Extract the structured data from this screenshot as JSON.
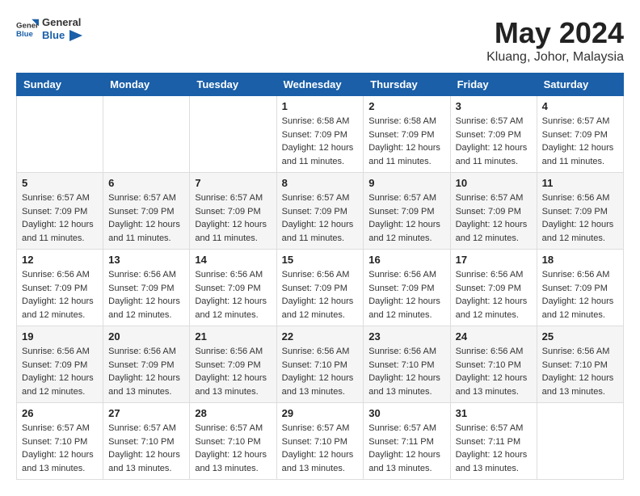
{
  "header": {
    "logo_general": "General",
    "logo_blue": "Blue",
    "title": "May 2024",
    "location": "Kluang, Johor, Malaysia"
  },
  "weekdays": [
    "Sunday",
    "Monday",
    "Tuesday",
    "Wednesday",
    "Thursday",
    "Friday",
    "Saturday"
  ],
  "weeks": [
    [
      {
        "day": "",
        "info": ""
      },
      {
        "day": "",
        "info": ""
      },
      {
        "day": "",
        "info": ""
      },
      {
        "day": "1",
        "info": "Sunrise: 6:58 AM\nSunset: 7:09 PM\nDaylight: 12 hours and 11 minutes."
      },
      {
        "day": "2",
        "info": "Sunrise: 6:58 AM\nSunset: 7:09 PM\nDaylight: 12 hours and 11 minutes."
      },
      {
        "day": "3",
        "info": "Sunrise: 6:57 AM\nSunset: 7:09 PM\nDaylight: 12 hours and 11 minutes."
      },
      {
        "day": "4",
        "info": "Sunrise: 6:57 AM\nSunset: 7:09 PM\nDaylight: 12 hours and 11 minutes."
      }
    ],
    [
      {
        "day": "5",
        "info": "Sunrise: 6:57 AM\nSunset: 7:09 PM\nDaylight: 12 hours and 11 minutes."
      },
      {
        "day": "6",
        "info": "Sunrise: 6:57 AM\nSunset: 7:09 PM\nDaylight: 12 hours and 11 minutes."
      },
      {
        "day": "7",
        "info": "Sunrise: 6:57 AM\nSunset: 7:09 PM\nDaylight: 12 hours and 11 minutes."
      },
      {
        "day": "8",
        "info": "Sunrise: 6:57 AM\nSunset: 7:09 PM\nDaylight: 12 hours and 11 minutes."
      },
      {
        "day": "9",
        "info": "Sunrise: 6:57 AM\nSunset: 7:09 PM\nDaylight: 12 hours and 12 minutes."
      },
      {
        "day": "10",
        "info": "Sunrise: 6:57 AM\nSunset: 7:09 PM\nDaylight: 12 hours and 12 minutes."
      },
      {
        "day": "11",
        "info": "Sunrise: 6:56 AM\nSunset: 7:09 PM\nDaylight: 12 hours and 12 minutes."
      }
    ],
    [
      {
        "day": "12",
        "info": "Sunrise: 6:56 AM\nSunset: 7:09 PM\nDaylight: 12 hours and 12 minutes."
      },
      {
        "day": "13",
        "info": "Sunrise: 6:56 AM\nSunset: 7:09 PM\nDaylight: 12 hours and 12 minutes."
      },
      {
        "day": "14",
        "info": "Sunrise: 6:56 AM\nSunset: 7:09 PM\nDaylight: 12 hours and 12 minutes."
      },
      {
        "day": "15",
        "info": "Sunrise: 6:56 AM\nSunset: 7:09 PM\nDaylight: 12 hours and 12 minutes."
      },
      {
        "day": "16",
        "info": "Sunrise: 6:56 AM\nSunset: 7:09 PM\nDaylight: 12 hours and 12 minutes."
      },
      {
        "day": "17",
        "info": "Sunrise: 6:56 AM\nSunset: 7:09 PM\nDaylight: 12 hours and 12 minutes."
      },
      {
        "day": "18",
        "info": "Sunrise: 6:56 AM\nSunset: 7:09 PM\nDaylight: 12 hours and 12 minutes."
      }
    ],
    [
      {
        "day": "19",
        "info": "Sunrise: 6:56 AM\nSunset: 7:09 PM\nDaylight: 12 hours and 12 minutes."
      },
      {
        "day": "20",
        "info": "Sunrise: 6:56 AM\nSunset: 7:09 PM\nDaylight: 12 hours and 13 minutes."
      },
      {
        "day": "21",
        "info": "Sunrise: 6:56 AM\nSunset: 7:09 PM\nDaylight: 12 hours and 13 minutes."
      },
      {
        "day": "22",
        "info": "Sunrise: 6:56 AM\nSunset: 7:10 PM\nDaylight: 12 hours and 13 minutes."
      },
      {
        "day": "23",
        "info": "Sunrise: 6:56 AM\nSunset: 7:10 PM\nDaylight: 12 hours and 13 minutes."
      },
      {
        "day": "24",
        "info": "Sunrise: 6:56 AM\nSunset: 7:10 PM\nDaylight: 12 hours and 13 minutes."
      },
      {
        "day": "25",
        "info": "Sunrise: 6:56 AM\nSunset: 7:10 PM\nDaylight: 12 hours and 13 minutes."
      }
    ],
    [
      {
        "day": "26",
        "info": "Sunrise: 6:57 AM\nSunset: 7:10 PM\nDaylight: 12 hours and 13 minutes."
      },
      {
        "day": "27",
        "info": "Sunrise: 6:57 AM\nSunset: 7:10 PM\nDaylight: 12 hours and 13 minutes."
      },
      {
        "day": "28",
        "info": "Sunrise: 6:57 AM\nSunset: 7:10 PM\nDaylight: 12 hours and 13 minutes."
      },
      {
        "day": "29",
        "info": "Sunrise: 6:57 AM\nSunset: 7:10 PM\nDaylight: 12 hours and 13 minutes."
      },
      {
        "day": "30",
        "info": "Sunrise: 6:57 AM\nSunset: 7:11 PM\nDaylight: 12 hours and 13 minutes."
      },
      {
        "day": "31",
        "info": "Sunrise: 6:57 AM\nSunset: 7:11 PM\nDaylight: 12 hours and 13 minutes."
      },
      {
        "day": "",
        "info": ""
      }
    ]
  ]
}
